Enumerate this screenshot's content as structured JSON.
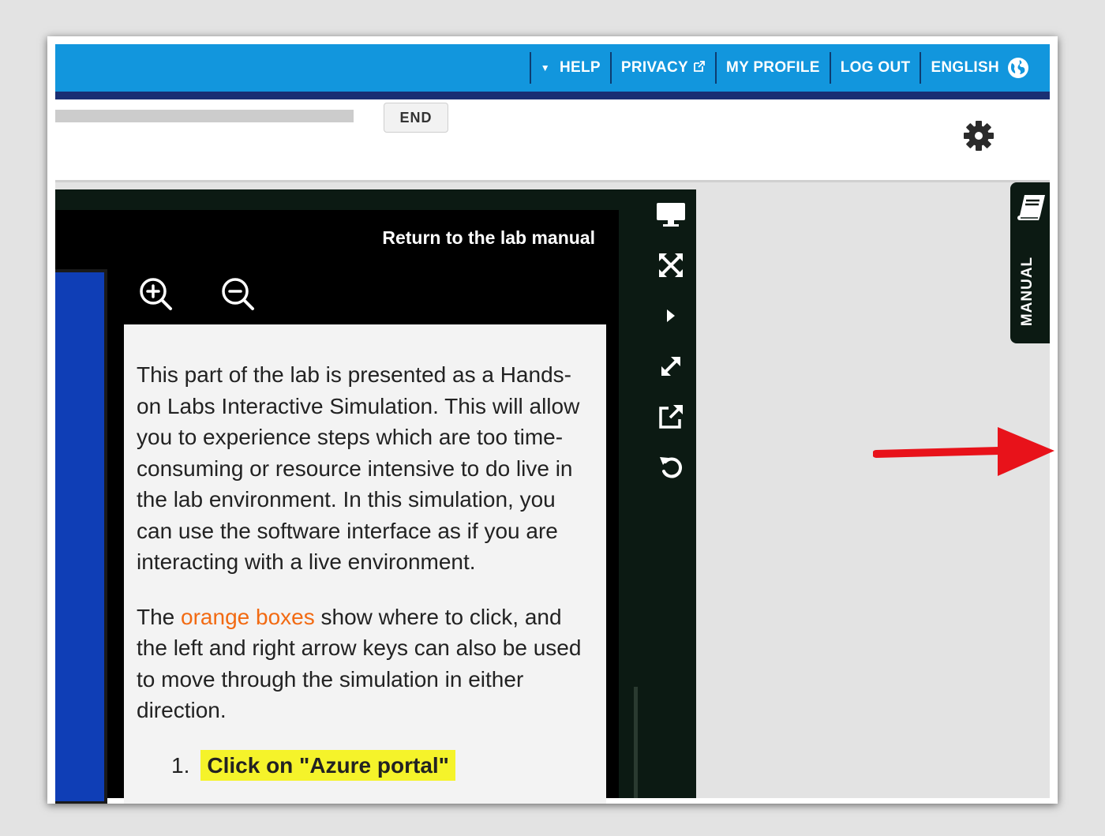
{
  "header": {
    "nav": [
      {
        "label": "HELP",
        "has_caret": true
      },
      {
        "label": "PRIVACY",
        "external": true
      },
      {
        "label": "MY PROFILE"
      },
      {
        "label": "LOG OUT"
      },
      {
        "label": "ENGLISH",
        "icon": "globe-icon"
      }
    ]
  },
  "toolbar_top": {
    "end_label": "END",
    "settings_icon": "gear-icon"
  },
  "simulation": {
    "return_link": "Return to the lab manual",
    "zoom_in_icon": "zoom-in-icon",
    "zoom_out_icon": "zoom-out-icon",
    "paragraph1": "This part of the lab is presented as a Hands-on Labs Interactive Simulation. This will allow you to experience steps which are too time-consuming or resource intensive to do live in the lab environment. In this simulation, you can use the software interface as if you are interacting with a live environment.",
    "paragraph2_prefix": "The ",
    "paragraph2_highlight": "orange boxes",
    "paragraph2_suffix": " show where to click, and the left and right arrow keys can also be used to move through the simulation in either direction.",
    "step_number": "1.",
    "step_text": "Click on \"Azure portal\""
  },
  "side_toolbar": {
    "icons": [
      "monitor-icon",
      "fullscreen-icon",
      "play-icon",
      "expand-icon",
      "external-link-icon",
      "reset-icon"
    ]
  },
  "manual_tab": {
    "label": "MANUAL",
    "icon": "book-icon"
  },
  "colors": {
    "header_blue": "#1296dd",
    "header_border": "#1a2f73",
    "panel_dark": "#0c1a13",
    "highlight_orange": "#f26a12",
    "step_yellow": "#f5f32a",
    "annotation_red": "#e8121a"
  }
}
